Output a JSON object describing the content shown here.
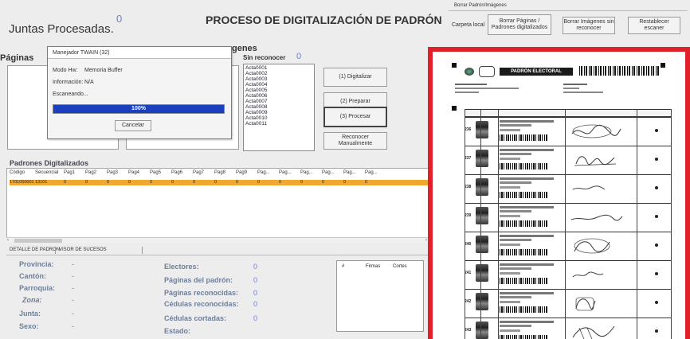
{
  "header": {
    "juntas_label": "Juntas Procesadas.",
    "juntas_count": "0",
    "title": "PROCESO DE DIGITALIZACIÓN DE PADRÓN"
  },
  "top_right": {
    "section_label": "Borrar Padrón/Imágenes",
    "carpeta_local": "Carpeta local",
    "borrar_paginas": "Borrar Páginas / Padrones digitalizados",
    "borrar_imagenes": "Borrar Imágenes sin reconocer",
    "restablecer": "Restablecer escaner"
  },
  "paginas": {
    "label": "Páginas"
  },
  "imagenes": {
    "label": "genes",
    "sin_reconocer_label": "Sin reconocer",
    "sin_reconocer_count": "0",
    "items": [
      "Acta0001",
      "Acta0002",
      "Acta0003",
      "Acta0004",
      "Acta0005",
      "Acta0006",
      "Acta0007",
      "Acta0008",
      "Acta0009",
      "Acta0010",
      "Acta0011"
    ]
  },
  "actions": {
    "digitalizar": "(1) Digitalizar",
    "preparar": "(2) Preparar",
    "procesar": "(3) Procesar",
    "reconocer": "Reconocer Manualmente"
  },
  "dialog": {
    "title": "Manejador TWAIN (32)",
    "modo_label": "Modo Hw:",
    "modo_value": "Memoria Buffer",
    "info_label": "Información:",
    "info_value": "N/A",
    "status": "Escaneando...",
    "progress_text": "100%",
    "progress": 1.0,
    "cancel": "Cancelar"
  },
  "padrones": {
    "label": "Padrones Digitalizados",
    "columns": [
      "Código",
      "Secuencial",
      "Pag1",
      "Pag2",
      "Pag3",
      "Pag4",
      "Pag5",
      "Pag6",
      "Pag7",
      "Pag8",
      "Pag9",
      "Pag...",
      "Pag...",
      "Pag...",
      "Pag...",
      "Pag...",
      "Pag..."
    ],
    "row": [
      "1701050001",
      "13101",
      "0",
      "0",
      "0",
      "0",
      "0",
      "0",
      "0",
      "0",
      "0",
      "0",
      "0",
      "0",
      "0",
      "0",
      "0"
    ]
  },
  "tabs": {
    "detalle": "DETALLE DE PADRON",
    "visor": "VISOR DE SUCESOS"
  },
  "detail": {
    "provincia": "Provincia:",
    "canton": "Cantón:",
    "parroquia": "Parroquia:",
    "zona": "Zona:",
    "junta": "Junta:",
    "sexo": "Sexo:",
    "dash": "-",
    "electores": "Electores:",
    "paginas_padron": "Páginas del padrón:",
    "paginas_reconocidas": "Páginas reconocidas:",
    "cedulas_reconocidas": "Cédulas reconocidas:",
    "cedulas_cortadas": "Cédulas cortadas:",
    "estado": "Estado:",
    "zero": "0"
  },
  "right_table": {
    "col1": "#",
    "col2": "Firmas",
    "col3": "Cortes"
  },
  "document": {
    "header_text": "PADRÓN ELECTORAL",
    "row_numbers": [
      "236",
      "237",
      "238",
      "239",
      "240",
      "241",
      "242",
      "243"
    ]
  },
  "colors": {
    "accent_red": "#e0202a",
    "row_highlight": "#f0a830",
    "progress": "#1a3fbf"
  }
}
